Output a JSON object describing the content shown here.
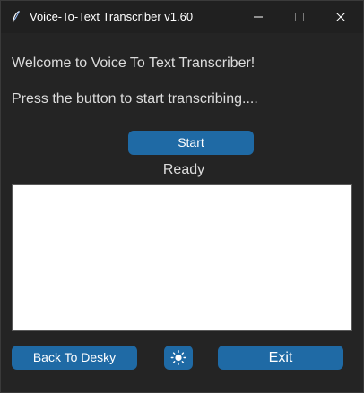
{
  "window": {
    "title": "Voice-To-Text Transcriber v1.60"
  },
  "main": {
    "welcome_text": "Welcome to Voice To Text Transcriber!",
    "instruction_text": "Press the button to start transcribing....",
    "start_label": "Start",
    "status_text": "Ready",
    "transcript_text": ""
  },
  "footer": {
    "back_label": "Back To Desky",
    "theme_icon": "sun-icon",
    "exit_label": "Exit"
  },
  "colors": {
    "background": "#242424",
    "titlebar": "#202020",
    "accent": "#1f6aa5",
    "text": "#dcdcdc",
    "textbox": "#ffffff"
  }
}
